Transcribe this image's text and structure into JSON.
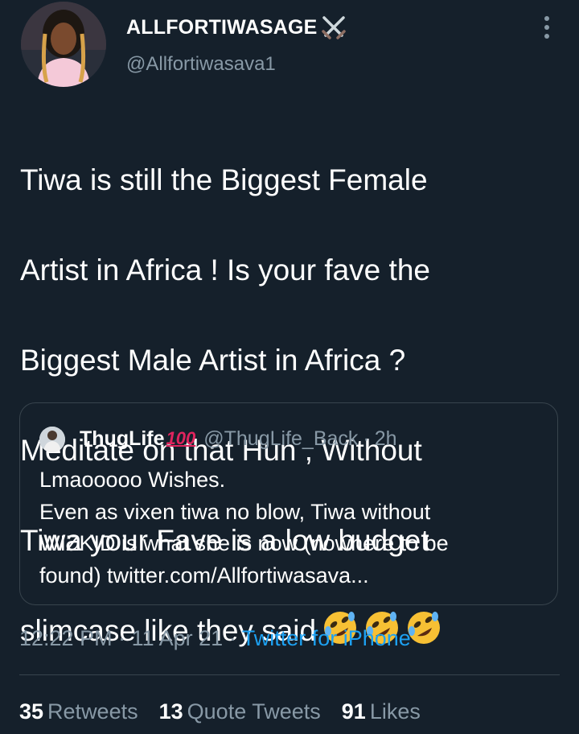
{
  "author": {
    "display_name": "ALLFORTIWASAGE",
    "badge_icon": "crossed-swords-icon",
    "handle": "@Allfortiwasava1"
  },
  "tweet": {
    "lines": [
      "Tiwa is still the Biggest Female",
      "Artist in Africa ! Is your fave the",
      "Biggest Male Artist in Africa ?",
      "Meditate on that Hun , Without",
      "Tiwa your Fave is a low budget",
      "slimcase like they said"
    ],
    "emoji_icons": [
      "rolling-on-floor-laughing-icon",
      "rolling-on-floor-laughing-icon",
      "rolling-on-floor-laughing-icon"
    ]
  },
  "quoted_tweet": {
    "display_name": "ThugLife",
    "badge_icon": "hundred-points-icon",
    "handle": "@ThugLife_Back",
    "separator": "·",
    "time": "2h",
    "lines": [
      "Lmaooooo Wishes.",
      "Even as vixen tiwa no blow, Tiwa without",
      "WIZKID is what she is now (nowhere to be",
      "found) twitter.com/Allfortiwasava..."
    ]
  },
  "meta": {
    "time": "12:22 PM",
    "separator": "·",
    "date": "11 Apr 21",
    "source": "Twitter for iPhone"
  },
  "stats": {
    "retweets_count": "35",
    "retweets_label": "Retweets",
    "quote_tweets_count": "13",
    "quote_tweets_label": "Quote Tweets",
    "likes_count": "91",
    "likes_label": "Likes"
  },
  "colors": {
    "background": "#15202b",
    "primary_text": "#ffffff",
    "secondary_text": "#8899a6",
    "accent": "#1da1f2",
    "border": "#38444d"
  }
}
